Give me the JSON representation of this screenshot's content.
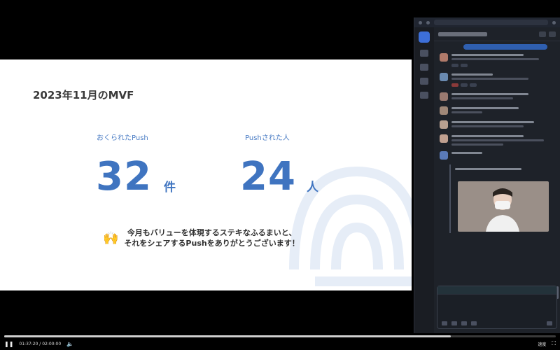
{
  "slide": {
    "title": "2023年11月のMVF",
    "stats": [
      {
        "label": "おくられたPush",
        "value": "32",
        "unit": "件"
      },
      {
        "label": "Pushされた人",
        "value": "24",
        "unit": "人"
      }
    ],
    "message_icon": "raised-hands-icon",
    "message_line1": "今月もバリューを体現するステキなふるまいと、",
    "message_line2": "それをシェアするPushをありがとうございます！"
  },
  "player": {
    "play_state_icon": "pause-icon",
    "time": "01:37:20 / 02:00:00",
    "progress": 0.81,
    "speed_label": "速度"
  },
  "colors": {
    "accent": "#3f74c0",
    "chat_bg": "#1e2229"
  }
}
